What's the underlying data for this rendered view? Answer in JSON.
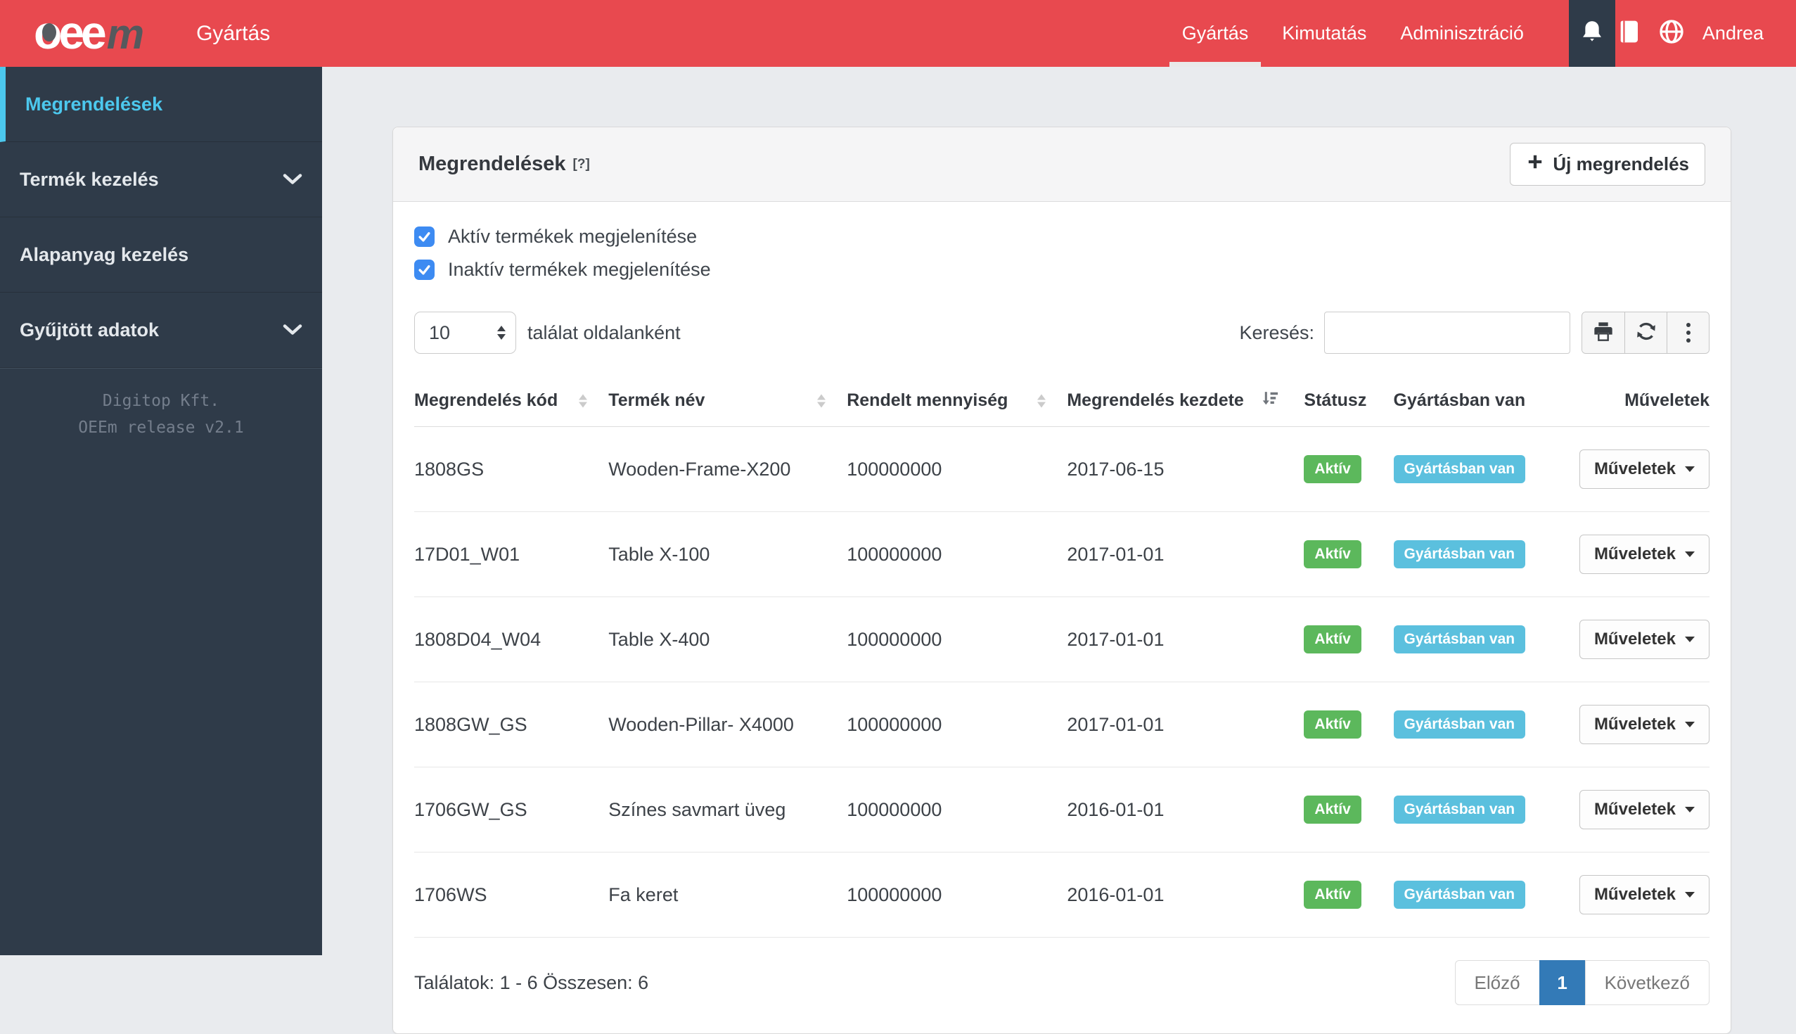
{
  "colors": {
    "navbar_bg": "#e8494f",
    "sidebar_bg": "#2f3b49",
    "sidebar_active_cyan": "#4cc8ee",
    "checkbox_blue": "#3d8bf2",
    "badge_active_green": "#5cb85c",
    "badge_production_blue": "#5bc0de",
    "pagination_active_blue": "#337ab7"
  },
  "icons": {
    "bell": "notifications",
    "book": "documentation",
    "globe": "language",
    "printer": "print-table",
    "refresh": "reload-table",
    "kebab": "more-options",
    "plus": "new-order",
    "chevron_down": "expand-submenu",
    "caret_down": "actions-dropdown",
    "sort_inactive": "sortable-column",
    "sort_desc": "sorted-descending"
  },
  "navbar": {
    "logo_white": "oee",
    "logo_gray": "m",
    "page_title": "Gyártás",
    "links": [
      {
        "label": "Gyártás",
        "active": true
      },
      {
        "label": "Kimutatás",
        "active": false
      },
      {
        "label": "Adminisztráció",
        "active": false
      }
    ],
    "user": "Andrea"
  },
  "sidebar": {
    "items": [
      {
        "label": "Megrendelések",
        "active": true,
        "has_chevron": false
      },
      {
        "label": "Termék kezelés",
        "active": false,
        "has_chevron": true
      },
      {
        "label": "Alapanyag kezelés",
        "active": false,
        "has_chevron": false
      },
      {
        "label": "Gyűjtött adatok",
        "active": false,
        "has_chevron": true
      }
    ],
    "footer": {
      "line1": "Digitop Kft.",
      "line2": "OEEm release v2.1"
    }
  },
  "panel": {
    "title": "Megrendelések",
    "help": "[?]",
    "new_order_button": "Új megrendelés",
    "filters": [
      {
        "label": "Aktív termékek megjelenítése",
        "checked": true
      },
      {
        "label": "Inaktív termékek megjelenítése",
        "checked": true
      }
    ],
    "page_size": {
      "value": "10",
      "label": "találat oldalanként"
    },
    "search": {
      "label": "Keresés:",
      "value": ""
    },
    "table": {
      "columns": [
        {
          "label": "Megrendelés kód",
          "sort": "unsorted"
        },
        {
          "label": "Termék név",
          "sort": "unsorted"
        },
        {
          "label": "Rendelt mennyiség",
          "sort": "unsorted"
        },
        {
          "label": "Megrendelés kezdete",
          "sort": "desc"
        },
        {
          "label": "Státusz",
          "sort": "none"
        },
        {
          "label": "Gyártásban van",
          "sort": "none"
        },
        {
          "label": "Műveletek",
          "sort": "none"
        }
      ],
      "rows": [
        {
          "code": "1808GS",
          "product": "Wooden-Frame-X200",
          "quantity": "100000000",
          "start_date": "2017-06-15",
          "status": "Aktív",
          "production": "Gyártásban van",
          "actions": "Műveletek"
        },
        {
          "code": "17D01_W01",
          "product": "Table X-100",
          "quantity": "100000000",
          "start_date": "2017-01-01",
          "status": "Aktív",
          "production": "Gyártásban van",
          "actions": "Műveletek"
        },
        {
          "code": "1808D04_W04",
          "product": "Table X-400",
          "quantity": "100000000",
          "start_date": "2017-01-01",
          "status": "Aktív",
          "production": "Gyártásban van",
          "actions": "Műveletek"
        },
        {
          "code": "1808GW_GS",
          "product": "Wooden-Pillar- X4000",
          "quantity": "100000000",
          "start_date": "2017-01-01",
          "status": "Aktív",
          "production": "Gyártásban van",
          "actions": "Műveletek"
        },
        {
          "code": "1706GW_GS",
          "product": "Színes savmart üveg",
          "quantity": "100000000",
          "start_date": "2016-01-01",
          "status": "Aktív",
          "production": "Gyártásban van",
          "actions": "Műveletek"
        },
        {
          "code": "1706WS",
          "product": "Fa keret",
          "quantity": "100000000",
          "start_date": "2016-01-01",
          "status": "Aktív",
          "production": "Gyártásban van",
          "actions": "Műveletek"
        }
      ]
    },
    "summary": "Találatok: 1 - 6 Összesen: 6",
    "pagination": {
      "prev": "Előző",
      "current_page": "1",
      "next": "Következő"
    }
  }
}
